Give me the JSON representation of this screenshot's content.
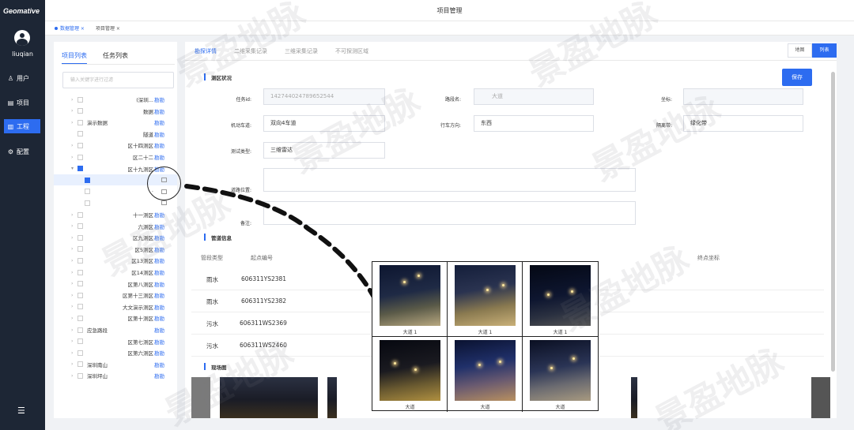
{
  "app": {
    "logo": "Geomative",
    "username": "liuqian",
    "title": "项目管理"
  },
  "nav": [
    {
      "label": "用户",
      "icon": "user-icon",
      "glyph": "♙"
    },
    {
      "label": "项目",
      "icon": "document-icon",
      "glyph": "▤"
    },
    {
      "label": "工程",
      "icon": "bar-chart-icon",
      "glyph": "▥"
    },
    {
      "label": "配置",
      "icon": "gear-icon",
      "glyph": "⚙"
    }
  ],
  "page_tabs": [
    {
      "label": "数据管理 ×"
    },
    {
      "label": "项目管理 ×"
    }
  ],
  "list_panel": {
    "tabs": [
      "项目列表",
      "任务列表"
    ],
    "search_placeholder": "输入关键字进行过滤",
    "action_label": "勘勘",
    "items": [
      {
        "name": "(深圳..."
      },
      {
        "name": "数据"
      },
      {
        "name": "演示数据"
      },
      {
        "name": "隧道"
      },
      {
        "name": "区十四测区"
      },
      {
        "name": "区二十二"
      },
      {
        "name": "区十九测区"
      },
      {
        "name": ""
      },
      {
        "name": "·"
      },
      {
        "name": ""
      },
      {
        "name": "十一测区"
      },
      {
        "name": "六测区"
      },
      {
        "name": "区九测区"
      },
      {
        "name": "区5测区"
      },
      {
        "name": "区13测区"
      },
      {
        "name": "区14测区"
      },
      {
        "name": "区第八测区"
      },
      {
        "name": "区第十三测区"
      },
      {
        "name": "大文演示测区"
      },
      {
        "name": "区第十测区"
      },
      {
        "name": "应急路段"
      },
      {
        "name": "区第七测区"
      },
      {
        "name": "区第六测区"
      },
      {
        "name": "深圳南山"
      },
      {
        "name": "深圳坪山"
      }
    ]
  },
  "main": {
    "tabs": [
      "勘探详情",
      "二维采集记录",
      "三维采集记录",
      "不可探测区域"
    ],
    "view_toggle": [
      "地图",
      "列表"
    ],
    "save_label": "保存",
    "sections": {
      "area": "测区状况",
      "pipe": "管道信息",
      "photos": "现场图"
    },
    "fields": {
      "task_id_label": "任务id:",
      "task_id_value": "142744024789652544",
      "road_name_label": "路段名:",
      "road_name_value": "大道",
      "coord_label": "坐标:",
      "lane_label": "机动车道:",
      "lane_value": "双向4车道",
      "direction_label": "行车方向:",
      "direction_value": "东西",
      "strip_label": "隔离带:",
      "strip_value": "绿化带",
      "type_label": "测试类型:",
      "type_value": "三维雷达",
      "location_label": "道路位置:",
      "remark_label": "备注:"
    },
    "pipe_table": {
      "headers": [
        "管段类型",
        "起点编号",
        "",
        "终点坐标"
      ],
      "rows": [
        [
          "雨水",
          "606311YS2381"
        ],
        [
          "雨水",
          "606311YS2382"
        ],
        [
          "污水",
          "606311WS2369"
        ],
        [
          "污水",
          "606311WS2460"
        ]
      ]
    }
  },
  "overlay_photos": [
    {
      "caption": "大道 1"
    },
    {
      "caption": "大道 1"
    },
    {
      "caption": "大道 1"
    },
    {
      "caption": "大道"
    },
    {
      "caption": "大道"
    },
    {
      "caption": "大道"
    }
  ],
  "watermark": "景盈地脉",
  "colors": {
    "accent": "#2d6cf0",
    "nav_bg": "#1d2635"
  }
}
